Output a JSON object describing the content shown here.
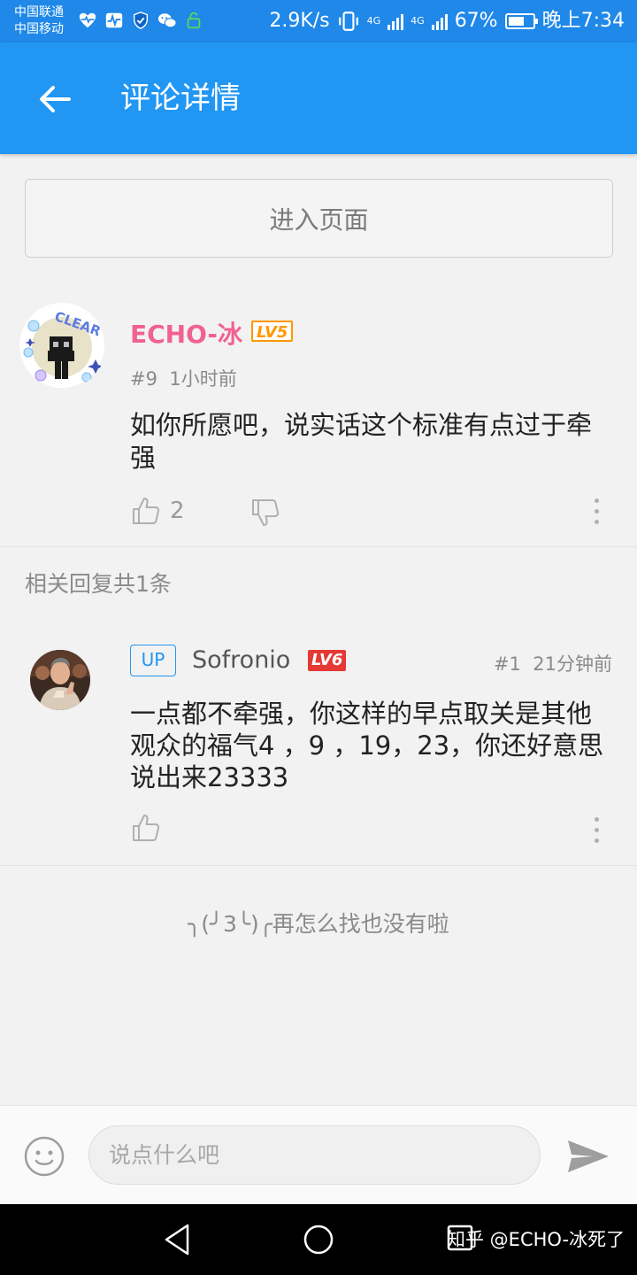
{
  "status_bar": {
    "carrier_1": "中国联通",
    "carrier_2": "中国移动",
    "speed": "2.9K/s",
    "network_1": "4G",
    "network_2": "4G",
    "battery": "67%",
    "battery_level": 0.67,
    "time": "晚上7:34"
  },
  "header": {
    "title": "评论详情"
  },
  "enter_page_label": "进入页面",
  "main_comment": {
    "author": "ECHO-冰",
    "level": "LV5",
    "floor": "#9",
    "time": "1小时前",
    "text": "如你所愿吧，说实话这个标准有点过于牵强",
    "likes": "2"
  },
  "replies_header": "相关回复共1条",
  "reply": {
    "tag": "UP",
    "author": "Sofronio",
    "level": "LV6",
    "floor": "#1",
    "time": "21分钟前",
    "text": "一点都不牵强，你这样的早点取关是其他观众的福气4 ，9 ，19，23，你还好意思说出来23333"
  },
  "end_text": "╮(╯3╰)╭再怎么找也没有啦",
  "input_bar": {
    "placeholder": "说点什么吧"
  },
  "watermark": "知乎 @ECHO-冰死了",
  "colors": {
    "status_bar": "#1f88e8",
    "header": "#2196f3",
    "author_1": "#f06292",
    "level_5": "#ff9800",
    "level_6": "#e53935",
    "up_tag": "#2196f3"
  }
}
